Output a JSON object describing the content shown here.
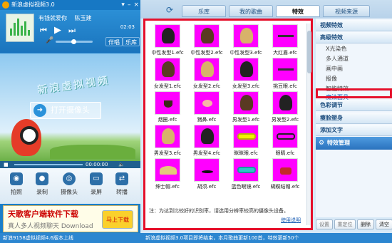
{
  "app": {
    "title": "新浪虚拟视频3.0"
  },
  "player": {
    "song_label": "有钱就爱你",
    "artist": "陈玉建",
    "time": "02:03",
    "btn_accompany": "伴唱",
    "btn_library": "乐库"
  },
  "video": {
    "brand": "新浪虚拟视频",
    "open_camera": "打开摄像头",
    "time": "00:00:00",
    "volume_percent": 40
  },
  "tools": [
    {
      "icon": "camera-icon",
      "label": "拍照"
    },
    {
      "icon": "record-icon",
      "label": "录制"
    },
    {
      "icon": "webcam-icon",
      "label": "摄像头"
    },
    {
      "icon": "screen-record-icon",
      "label": "录屏"
    },
    {
      "icon": "broadcast-icon",
      "label": "转播"
    }
  ],
  "banner": {
    "title": "天歌客户端软件下载",
    "sub": "真人多人视频聊天 Download",
    "badge": "马上下载"
  },
  "status": {
    "left": "新浪9158虚拟视频4.6版本上线",
    "right": "新浪虚拟视频3.0项目即将结束，本月歌曲更新100首，特效更新50个"
  },
  "tabs": [
    {
      "label": "乐库",
      "active": false
    },
    {
      "label": "我的歌曲",
      "active": false
    },
    {
      "label": "特效",
      "active": true
    },
    {
      "label": "视频来源",
      "active": false
    }
  ],
  "effects": [
    {
      "name": "中性发型1.efc",
      "kind": "hair",
      "tone": "dark"
    },
    {
      "name": "中性发型2.efc",
      "kind": "hair",
      "tone": "brown"
    },
    {
      "name": "中性发型3.efc",
      "kind": "hair",
      "tone": "light"
    },
    {
      "name": "大红眉.efc",
      "kind": "brow",
      "tone": "dark"
    },
    {
      "name": "女发型1.efc",
      "kind": "hair",
      "tone": "brown"
    },
    {
      "name": "女发型2.efc",
      "kind": "hair",
      "tone": "light"
    },
    {
      "name": "女发型3.efc",
      "kind": "hair",
      "tone": "dark"
    },
    {
      "name": "挑豆眼.efc",
      "kind": "brow",
      "tone": "dark"
    },
    {
      "name": "烟圈.efc",
      "kind": "beard",
      "tone": "dark"
    },
    {
      "name": "猪鼻.efc",
      "kind": "nose",
      "tone": "pink"
    },
    {
      "name": "男发型1.efc",
      "kind": "hair",
      "tone": "teal"
    },
    {
      "name": "男发型2.efc",
      "kind": "hair",
      "tone": "dark"
    },
    {
      "name": "男发型3.efc",
      "kind": "hair",
      "tone": "light"
    },
    {
      "name": "男发型4.efc",
      "kind": "hair",
      "tone": "dark"
    },
    {
      "name": "眯眯眼.efc",
      "kind": "glass",
      "tone": "yellow"
    },
    {
      "name": "眼睛.efc",
      "kind": "glass",
      "tone": "dark"
    },
    {
      "name": "绅士帽.efc",
      "kind": "hat",
      "tone": "light"
    },
    {
      "name": "胡须.efc",
      "kind": "moust",
      "tone": "dark"
    },
    {
      "name": "蓝色眼镜.efc",
      "kind": "glass",
      "tone": "teal"
    },
    {
      "name": "蝴蝶结帽.efc",
      "kind": "bow",
      "tone": "red"
    }
  ],
  "note": "注：为达到比较好的识别率，请选用分辨率较高的摄像头设备。",
  "usage_link": "使用说明",
  "sidebar": {
    "sections": [
      {
        "label": "视频特效"
      },
      {
        "label": "高级特效"
      }
    ],
    "items": [
      {
        "label": "X光染色",
        "highlight": false
      },
      {
        "label": "多人通道",
        "highlight": false
      },
      {
        "label": "画中画",
        "highlight": false
      },
      {
        "label": "报像",
        "highlight": false
      },
      {
        "label": "智能特效",
        "highlight": false
      },
      {
        "label": "魔法面具",
        "highlight": true
      }
    ],
    "more_sections": [
      {
        "label": "色彩调节"
      },
      {
        "label": "瘦脸塑身"
      },
      {
        "label": "添加文字"
      }
    ],
    "manage": "特效管理"
  },
  "buttons": {
    "set": "设置",
    "reset": "重定位",
    "delete": "删除",
    "clear": "清空"
  }
}
